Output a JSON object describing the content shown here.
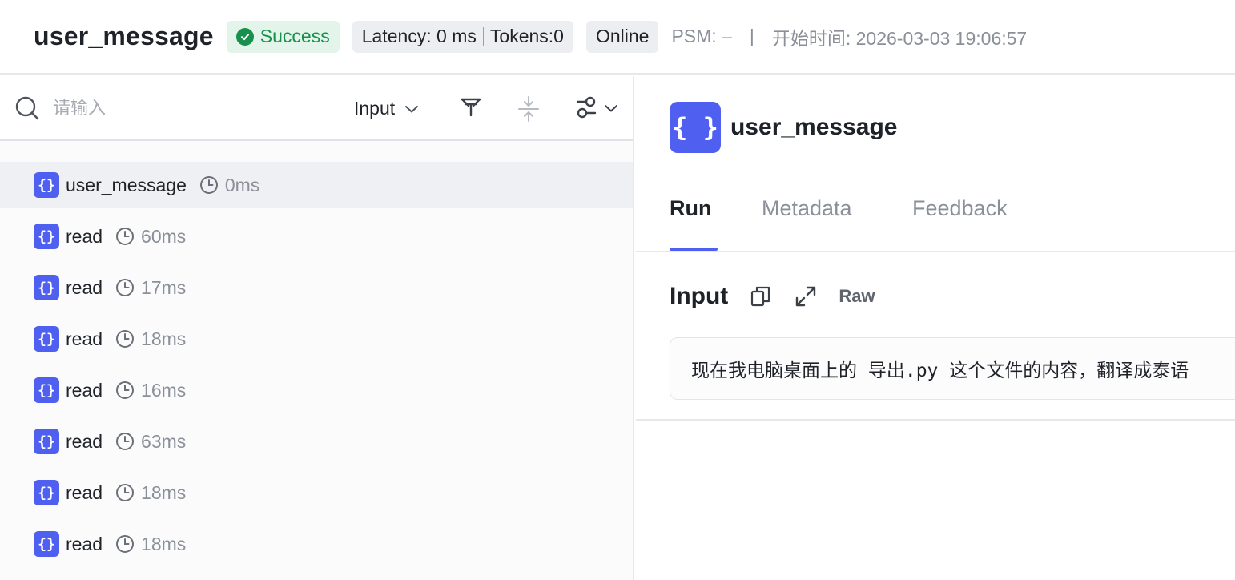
{
  "header": {
    "title": "user_message",
    "status": "Success",
    "latency": "Latency: 0 ms",
    "tokens": "Tokens:0",
    "env": "Online",
    "psm": "PSM: –",
    "separator": "|",
    "start_time": "开始时间: 2026-03-03 19:06:57",
    "colors": {
      "success": "#16904c",
      "success_bg": "#e3f5ea",
      "accent": "#4f5ff0"
    }
  },
  "toolbar": {
    "search_placeholder": "请输入",
    "dropdown_label": "Input",
    "icons": [
      "search-icon",
      "filter-icon",
      "collapse-icon",
      "settings-toggle-icon",
      "chevron-down-icon"
    ]
  },
  "tree": {
    "nodes": [
      {
        "name": "user_message",
        "duration": "0ms",
        "selected": true
      },
      {
        "name": "read",
        "duration": "60ms"
      },
      {
        "name": "read",
        "duration": "17ms"
      },
      {
        "name": "read",
        "duration": "18ms"
      },
      {
        "name": "read",
        "duration": "16ms"
      },
      {
        "name": "read",
        "duration": "63ms"
      },
      {
        "name": "read",
        "duration": "18ms"
      },
      {
        "name": "read",
        "duration": "18ms"
      }
    ],
    "icon_glyph": "{}"
  },
  "detail": {
    "icon_glyph": "{ }",
    "title": "user_message",
    "tabs": [
      {
        "label": "Run",
        "active": true
      },
      {
        "label": "Metadata"
      },
      {
        "label": "Feedback"
      }
    ],
    "section_title": "Input",
    "raw_label": "Raw",
    "input_value": "现在我电脑桌面上的 导出.py 这个文件的内容，翻译成泰语"
  }
}
